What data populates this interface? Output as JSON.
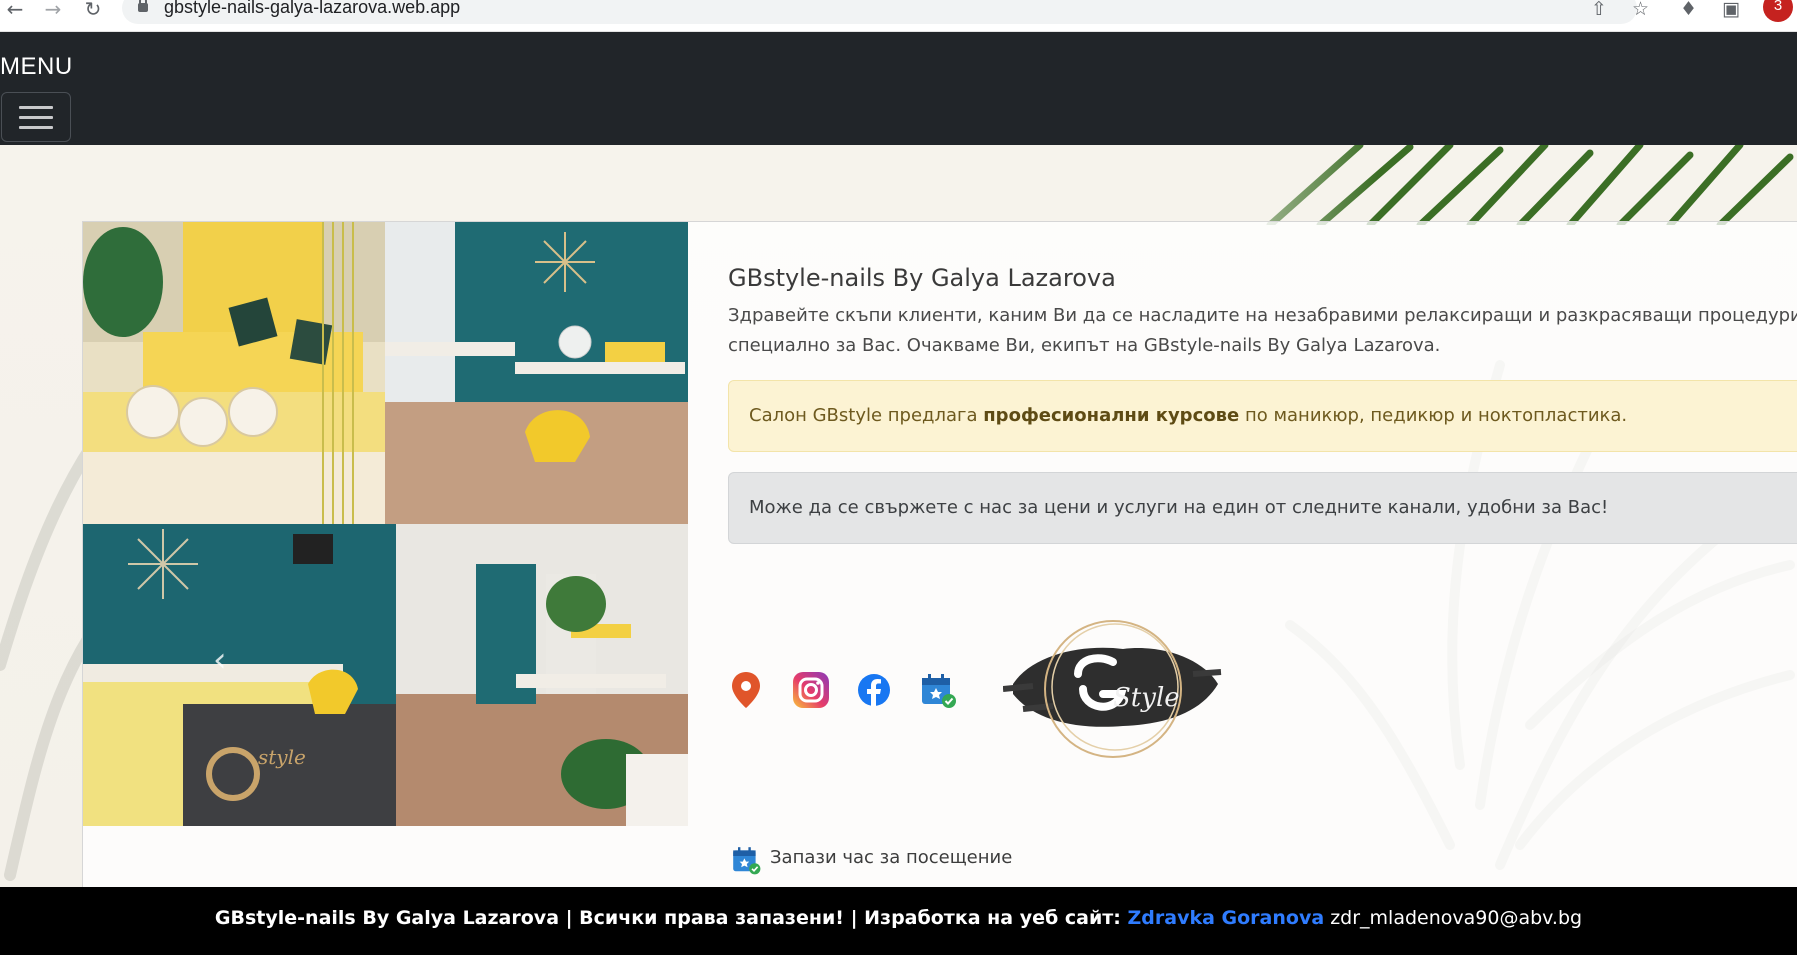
{
  "browser": {
    "url": "gbstyle-nails-galya-lazarova.web.app",
    "profile_badge": "3"
  },
  "navbar": {
    "brand": "MENU"
  },
  "hero": {
    "title": "GBstyle-nails By Galya Lazarova",
    "intro": "Здравейте скъпи клиенти, каним Ви да се насладите на незабравими релаксиращи и разкрасяващи процедури специално за Вас. Очакваме Ви, екипът на GBstyle-nails By Galya Lazarova.",
    "courses_alert": {
      "prefix": "Салон GBstyle предлага ",
      "bold": "професионални курсове",
      "suffix": " по маникюр, педикюр и ноктопластика."
    },
    "contact_alert": "Може да се свържете с нас за цени и услуги на един от следните канали, удобни за Вас!",
    "logo_text": "Style",
    "booking_label": "Запази час за посещение"
  },
  "social_icons": [
    "location-pin-icon",
    "instagram-icon",
    "facebook-icon",
    "calendar-booking-icon"
  ],
  "footer": {
    "main": "GBstyle-nails By Galya Lazarova | Всички права запазени! | Изработка на уеб сайт: ",
    "author": "Zdravka Goranova",
    "email": " zdr_mladenova90@abv.bg"
  },
  "colors": {
    "navbar": "#212529",
    "footer": "#000000",
    "warn_alert_bg": "#fcf3d3",
    "gray_alert_bg": "#e4e5e6",
    "author_link": "#2f7cff"
  }
}
